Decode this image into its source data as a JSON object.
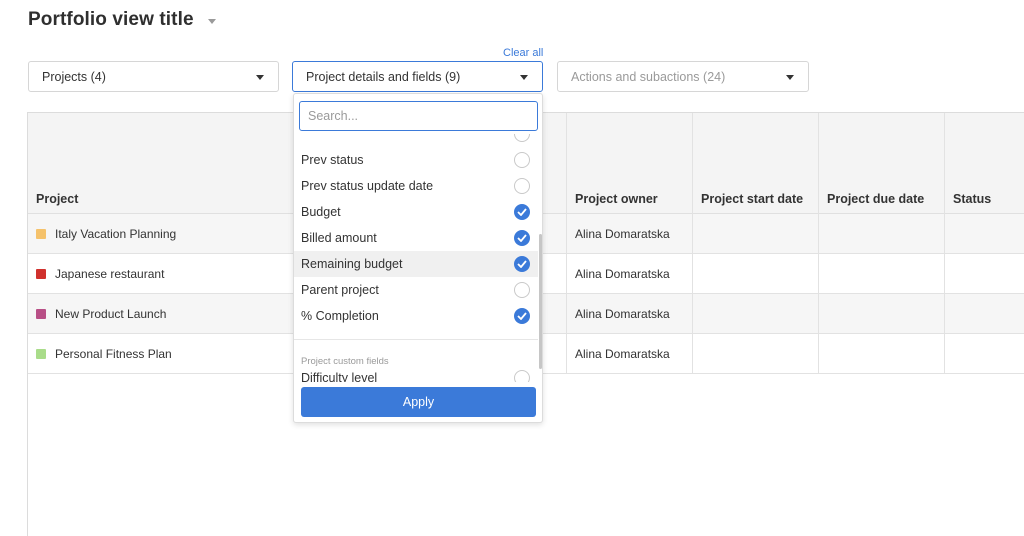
{
  "header": {
    "title": "Portfolio view title"
  },
  "filters": {
    "clear_all": "Clear all",
    "projects": "Projects (4)",
    "details": "Project details and fields (9)",
    "actions": "Actions and subactions (24)"
  },
  "table": {
    "columns": [
      "Project",
      "Project owner",
      "Project start date",
      "Project due date",
      "Status"
    ],
    "rows": [
      {
        "name": "Italy Vacation Planning",
        "color": "#f5c26b",
        "owner": "Alina Domaratska"
      },
      {
        "name": "Japanese restaurant",
        "color": "#d0312d",
        "owner": "Alina Domaratska"
      },
      {
        "name": "New Product Launch",
        "color": "#b84f86",
        "owner": "Alina Domaratska"
      },
      {
        "name": "Personal Fitness Plan",
        "color": "#a9dc8a",
        "owner": "Alina Domaratska"
      }
    ]
  },
  "dropdown": {
    "search_placeholder": "Search...",
    "options": [
      {
        "label": "Prev status",
        "checked": false
      },
      {
        "label": "Prev status update date",
        "checked": false
      },
      {
        "label": "Budget",
        "checked": true
      },
      {
        "label": "Billed amount",
        "checked": true
      },
      {
        "label": "Remaining budget",
        "checked": true
      },
      {
        "label": "Parent project",
        "checked": false
      },
      {
        "label": "% Completion",
        "checked": true
      }
    ],
    "custom_group_label": "Project custom fields",
    "custom_options": [
      {
        "label": "Difficulty level",
        "checked": false
      }
    ],
    "apply_label": "Apply"
  },
  "colors": {
    "accent": "#3b7ad9"
  }
}
